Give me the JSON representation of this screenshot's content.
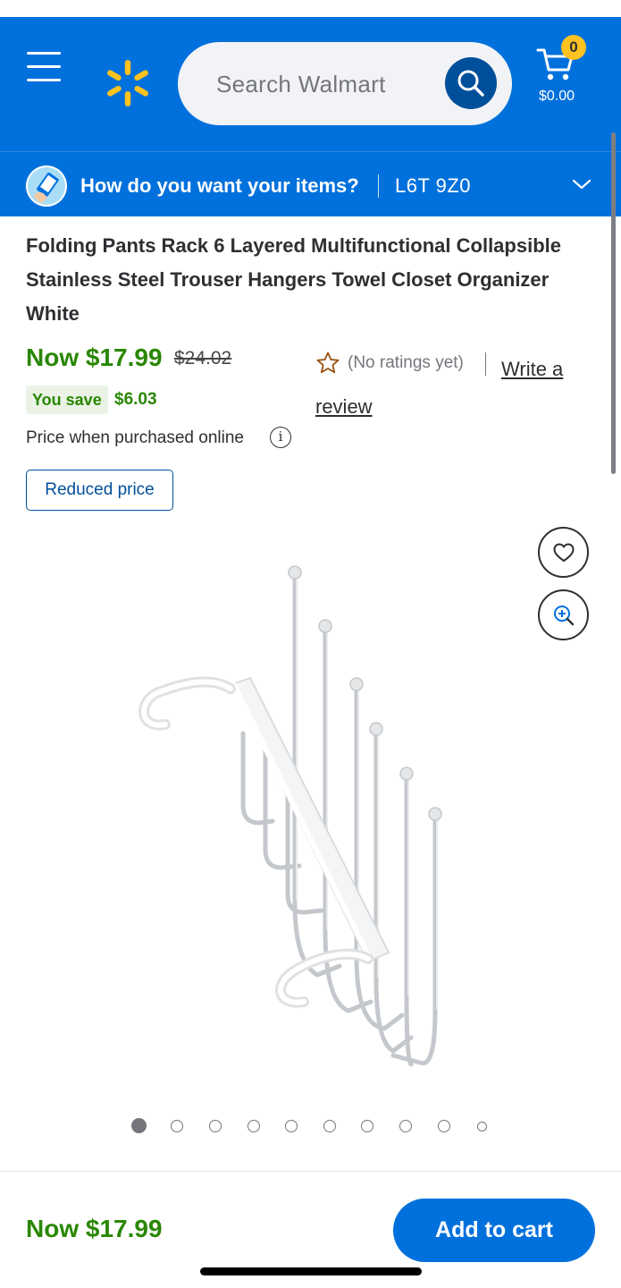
{
  "header": {
    "search_placeholder": "Search Walmart",
    "cart_count": "0",
    "cart_total": "$0.00",
    "brand_color": "#0071dc",
    "spark_color": "#ffc220"
  },
  "intent": {
    "question": "How do you want your items?",
    "postal_code": "L6T 9Z0"
  },
  "product": {
    "title": "Folding Pants Rack 6 Layered Multifunctional Collapsible Stainless Steel Trouser Hangers Towel Closet Organizer White",
    "now_price": "Now $17.99",
    "was_price": "$24.02",
    "you_save_label": "You save",
    "you_save_amount": "$6.03",
    "price_note": "Price when purchased online",
    "badge": "Reduced price",
    "rating_text": "(No ratings yet)",
    "review_link_line1": "Write a",
    "review_link_line2": "review",
    "image_count": 10,
    "active_image_index": 0
  },
  "bottom_bar": {
    "price": "Now $17.99",
    "add_to_cart_label": "Add to cart",
    "price_color": "#2a8703"
  },
  "icons": [
    "hamburger-menu-icon",
    "walmart-spark-logo",
    "search-icon",
    "cart-icon",
    "delivery-intent-icon",
    "chevron-down-icon",
    "star-outline-icon",
    "info-icon",
    "heart-icon",
    "zoom-in-icon"
  ]
}
